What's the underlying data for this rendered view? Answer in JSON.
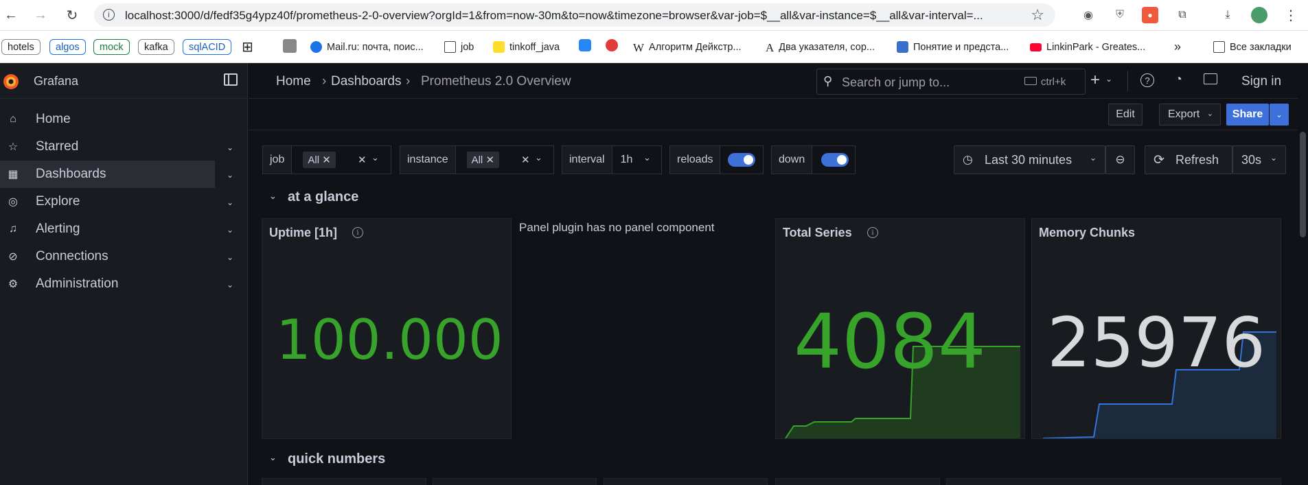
{
  "browser": {
    "url": "localhost:3000/d/fedf35g4ypz40f/prometheus-2-0-overview?orgId=1&from=now-30m&to=now&timezone=browser&var-job=$__all&var-instance=$__all&var-interval=...",
    "bookmarks": {
      "pills": [
        "hotels",
        "algos",
        "mock",
        "kafka",
        "sqlACID"
      ],
      "items": [
        "Mail.ru: почта, поис...",
        "job",
        "tinkoff_java",
        "Алгоритм Дейкстр...",
        "Два указателя, сор...",
        "Понятие и предста...",
        "LinkinPark - Greates..."
      ],
      "all_bookmarks": "Все закладки"
    }
  },
  "app": {
    "name": "Grafana"
  },
  "sidebar": {
    "items": [
      {
        "label": "Home"
      },
      {
        "label": "Starred"
      },
      {
        "label": "Dashboards"
      },
      {
        "label": "Explore"
      },
      {
        "label": "Alerting"
      },
      {
        "label": "Connections"
      },
      {
        "label": "Administration"
      }
    ]
  },
  "breadcrumb": {
    "home": "Home",
    "dashboards": "Dashboards",
    "current": "Prometheus 2.0 Overview",
    "sep": "›"
  },
  "search": {
    "placeholder": "Search or jump to...",
    "shortcut": "ctrl+k"
  },
  "topbar": {
    "sign_in": "Sign in",
    "plus": "+"
  },
  "actions": {
    "edit": "Edit",
    "export": "Export",
    "share": "Share"
  },
  "variables": {
    "job": {
      "label": "job",
      "value": "All"
    },
    "instance": {
      "label": "instance",
      "value": "All"
    },
    "interval": {
      "label": "interval",
      "value": "1h"
    },
    "reloads": {
      "label": "reloads"
    },
    "down": {
      "label": "down"
    }
  },
  "time": {
    "range": "Last 30 minutes",
    "refresh": "Refresh",
    "interval": "30s"
  },
  "rows": {
    "at_a_glance": "at a glance",
    "quick_numbers": "quick numbers"
  },
  "panels": {
    "uptime": {
      "title": "Uptime [1h]",
      "value": "100.000"
    },
    "plugin_error": "Panel plugin has no panel component",
    "total_series": {
      "title": "Total Series",
      "value": "4084"
    },
    "memory_chunks": {
      "title": "Memory Chunks",
      "value": "25976"
    }
  },
  "colors": {
    "green": "#37a32b",
    "blue": "#3d71d9",
    "text": "#ccccdc",
    "mem_value": "#d8d9da"
  }
}
